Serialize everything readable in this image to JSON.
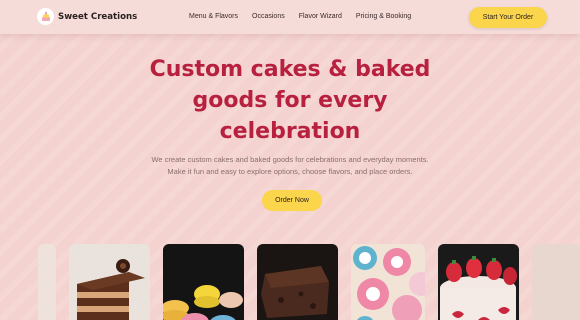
{
  "brand": {
    "name": "Sweet Creations",
    "logo_icon": "cake-logo-icon"
  },
  "nav": {
    "links": [
      "Menu & Flavors",
      "Occasions",
      "Flavor Wizard",
      "Pricing & Booking"
    ],
    "cta_label": "Start Your Order"
  },
  "hero": {
    "title_lines": [
      "Custom cakes & baked",
      "goods for every",
      "celebration"
    ],
    "subtitle_lines": [
      "We create custom cakes and baked goods for celebrations and everyday moments.",
      "Make it fun and easy to explore options, choose flavors, and place orders."
    ],
    "button_label": "Order Now"
  },
  "gallery": {
    "items": [
      "chocolate-layer-cake",
      "macarons",
      "brownie",
      "decorated-cookies",
      "strawberry-cake"
    ]
  },
  "colors": {
    "background": "#f4d2cf",
    "accent": "#fbd64c",
    "title": "#b8203f"
  }
}
